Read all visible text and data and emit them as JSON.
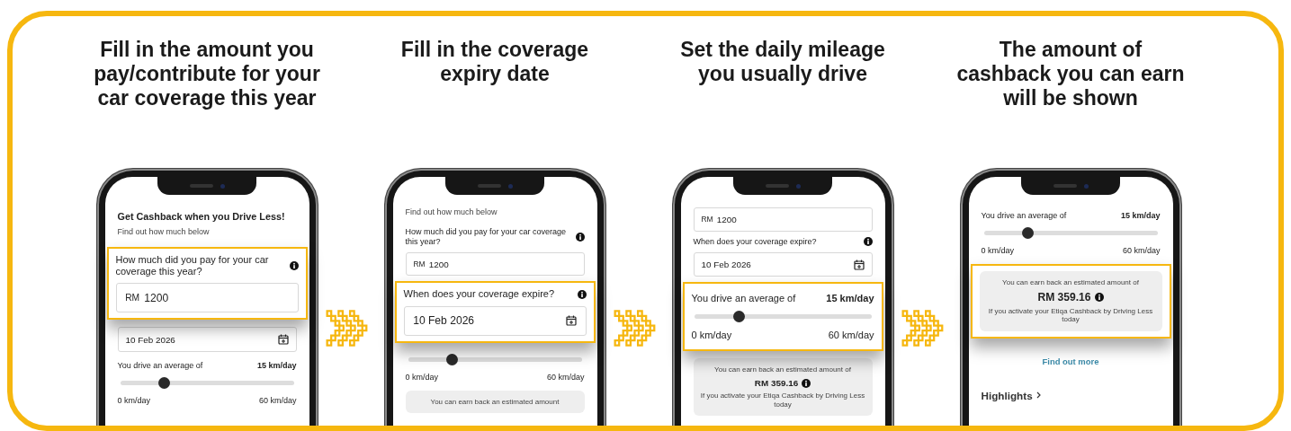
{
  "steps": [
    {
      "heading": "Fill in the amount you pay/contribute for your car coverage this year",
      "screen": {
        "blocks": [
          {
            "highlighted": false,
            "items": [
              {
                "kind": "title",
                "text": "Get Cashback when you Drive Less!"
              },
              {
                "kind": "subtitle",
                "text": "Find out how much below"
              }
            ]
          },
          {
            "highlighted": true,
            "items": [
              {
                "kind": "question",
                "text": "How much did you pay for your car coverage this year?",
                "info": true
              },
              {
                "kind": "amount",
                "prefix": "RM",
                "value": "1200"
              }
            ]
          },
          {
            "highlighted": false,
            "items": [
              {
                "kind": "date",
                "value": "10 Feb 2026"
              },
              {
                "kind": "slider",
                "label": "You drive an average of",
                "value": "15 km/day",
                "level": 0.25,
                "min": "0 km/day",
                "max": "60 km/day"
              }
            ]
          }
        ]
      }
    },
    {
      "heading": "Fill in the coverage expiry date",
      "screen": {
        "blocks": [
          {
            "highlighted": false,
            "items": [
              {
                "kind": "subtitle",
                "text": "Find out how much below"
              },
              {
                "kind": "question",
                "text": "How much did you pay for your car coverage this year?",
                "info": true
              },
              {
                "kind": "amount",
                "prefix": "RM",
                "value": "1200"
              }
            ]
          },
          {
            "highlighted": true,
            "items": [
              {
                "kind": "question",
                "text": "When does your coverage expire?",
                "info": true
              },
              {
                "kind": "date",
                "value": "10 Feb 2026"
              }
            ]
          },
          {
            "highlighted": false,
            "items": [
              {
                "kind": "slider",
                "level": 0.25,
                "min": "0 km/day",
                "max": "60 km/day"
              },
              {
                "kind": "result",
                "intro": "You can earn back an estimated amount"
              }
            ]
          }
        ]
      }
    },
    {
      "heading": "Set the daily mileage you usually drive",
      "screen": {
        "blocks": [
          {
            "highlighted": false,
            "items": [
              {
                "kind": "amount",
                "prefix": "RM",
                "value": "1200"
              },
              {
                "kind": "question",
                "text": "When does your coverage expire?",
                "info": true
              },
              {
                "kind": "date",
                "value": "10 Feb 2026"
              }
            ]
          },
          {
            "highlighted": true,
            "items": [
              {
                "kind": "slider",
                "label": "You drive an average of",
                "value": "15 km/day",
                "level": 0.25,
                "min": "0 km/day",
                "max": "60 km/day"
              }
            ]
          },
          {
            "highlighted": false,
            "items": [
              {
                "kind": "result",
                "intro": "You can earn back an estimated amount of",
                "amount": "RM 359.16",
                "info": true,
                "note": "If you activate your Etiqa Cashback by Driving Less today"
              }
            ]
          }
        ]
      }
    },
    {
      "heading": "The amount of cashback you can earn will be shown",
      "screen": {
        "blocks": [
          {
            "highlighted": false,
            "items": [
              {
                "kind": "slider",
                "label": "You drive an average of",
                "value": "15 km/day",
                "level": 0.25,
                "min": "0 km/day",
                "max": "60 km/day"
              }
            ]
          },
          {
            "highlighted": true,
            "items": [
              {
                "kind": "result",
                "intro": "You can earn back an estimated amount of",
                "amount": "RM 359.16",
                "info": true,
                "note": "If you activate your Etiqa Cashback by Driving Less today"
              }
            ]
          },
          {
            "highlighted": false,
            "items": [
              {
                "kind": "link",
                "text": "Find out more"
              },
              {
                "kind": "section",
                "text": "Highlights"
              }
            ]
          }
        ]
      }
    }
  ]
}
